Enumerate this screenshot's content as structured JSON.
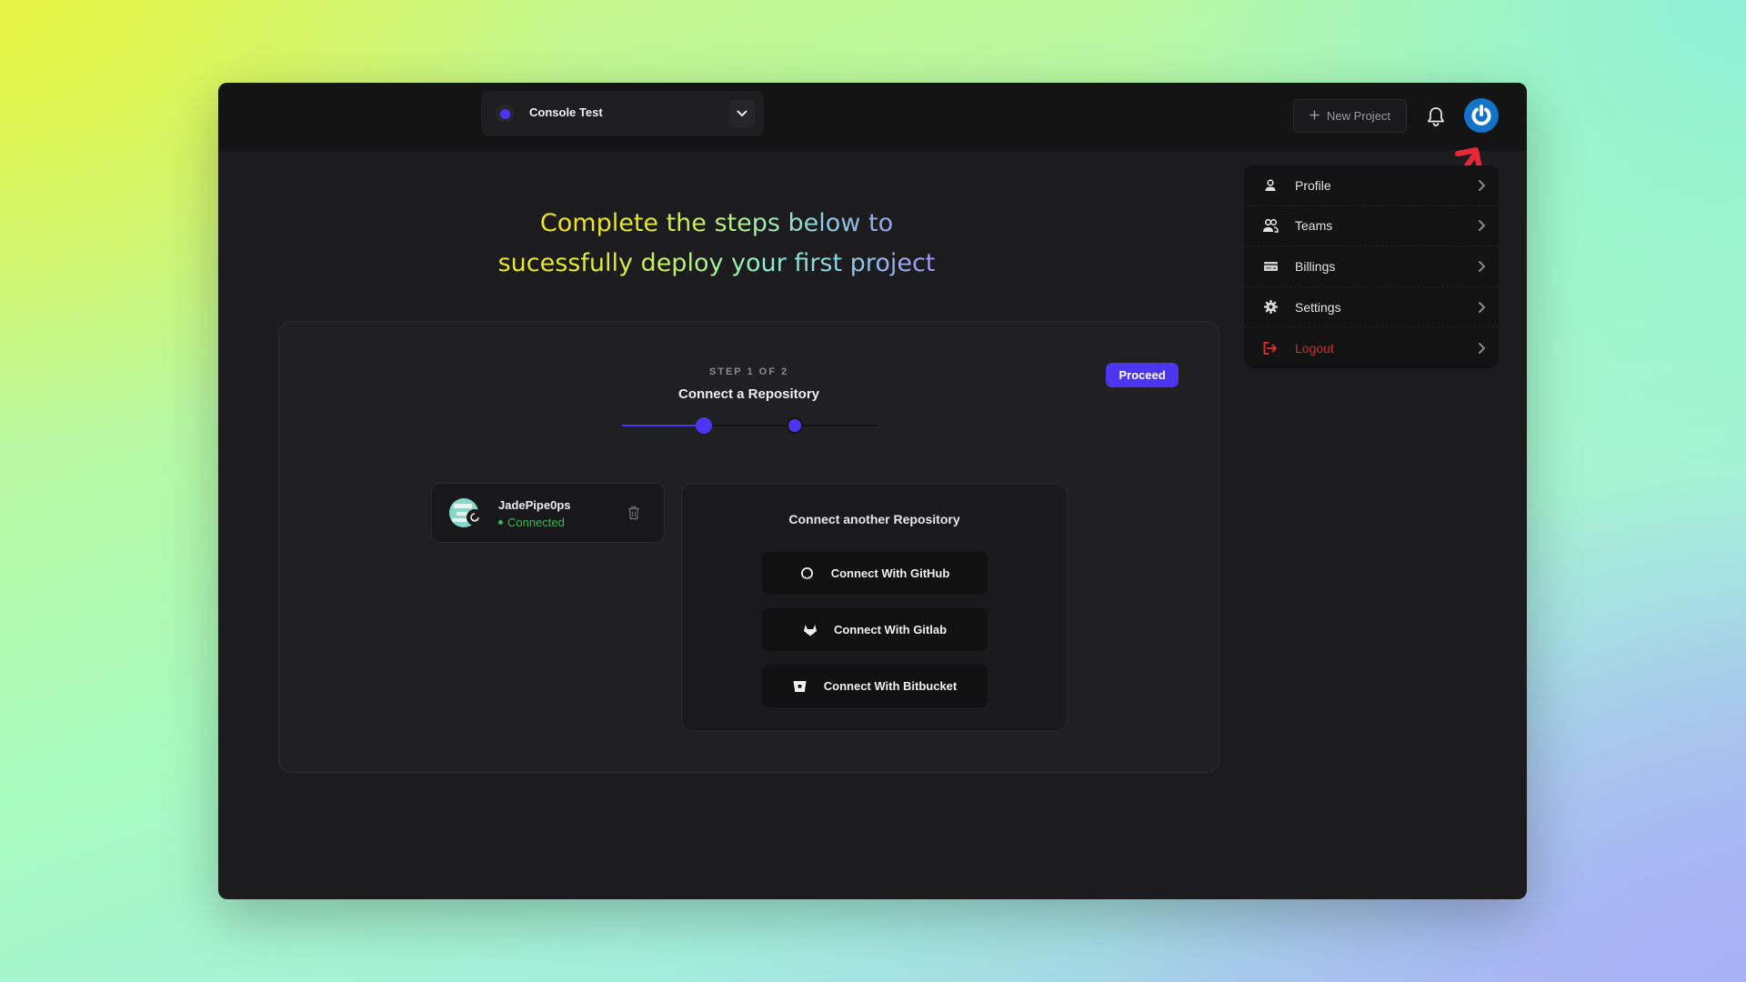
{
  "header": {
    "project": {
      "name": "Console Test",
      "dot_color": "#4b35f0"
    },
    "new_project_label": "New Project",
    "avatar_color": "#1273c9"
  },
  "user_menu": {
    "items": [
      {
        "label": "Profile",
        "icon": "user-icon"
      },
      {
        "label": "Teams",
        "icon": "users-icon"
      },
      {
        "label": "Billings",
        "icon": "credit-card-icon"
      },
      {
        "label": "Settings",
        "icon": "gear-icon"
      },
      {
        "label": "Logout",
        "icon": "logout-icon",
        "color": "#d62b2b"
      }
    ]
  },
  "headline": {
    "line1": "Complete the steps below to",
    "line2": "sucessfully deploy your first project"
  },
  "wizard": {
    "step_label": "STEP 1 OF 2",
    "step_title": "Connect a Repository",
    "current_step": 1,
    "total_steps": 2,
    "progress": 0.32,
    "proceed_label": "Proceed",
    "accent": "#4b35f0"
  },
  "connected_repo": {
    "name": "JadePipe0ps",
    "status": "Connected",
    "status_color": "#39b75a"
  },
  "connect_another": {
    "title": "Connect another Repository",
    "buttons": [
      {
        "label": "Connect With GitHub",
        "icon": "github-icon"
      },
      {
        "label": "Connect With Gitlab",
        "icon": "gitlab-icon"
      },
      {
        "label": "Connect With Bitbucket",
        "icon": "bitbucket-icon"
      }
    ]
  }
}
